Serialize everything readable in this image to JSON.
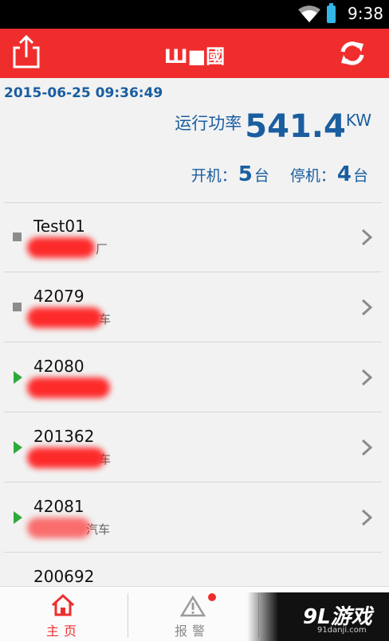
{
  "status_bar": {
    "time": "9:38"
  },
  "header": {
    "title": "Ш■國",
    "share_icon": "share-upload-icon",
    "refresh_icon": "refresh-icon",
    "accent_color": "#f02d2d"
  },
  "summary": {
    "datetime": "2015-06-25 09:36:49",
    "power_label": "运行功率",
    "power_value": "541.4",
    "power_unit": "KW",
    "running_label": "开机：",
    "running_count": "5",
    "running_unit": "台",
    "stopped_label": "停机：",
    "stopped_count": "4",
    "stopped_unit": "台",
    "text_color": "#1a5ea0"
  },
  "devices": [
    {
      "name": "Test01",
      "desc": "厂",
      "status": "stopped"
    },
    {
      "name": "42079",
      "desc": "车",
      "status": "stopped"
    },
    {
      "name": "42080",
      "desc": "",
      "status": "running"
    },
    {
      "name": "201362",
      "desc": "车",
      "status": "running"
    },
    {
      "name": "42081",
      "desc": "汽车",
      "status": "running"
    },
    {
      "name": "200692",
      "desc": "",
      "status": "unknown"
    }
  ],
  "tabs": [
    {
      "label": "主页",
      "icon": "home-icon",
      "active": true
    },
    {
      "label": "报警",
      "icon": "alert-triangle-icon",
      "active": false,
      "badge": true
    }
  ],
  "watermark": {
    "main": "9L游戏",
    "sub": "91danji.com"
  }
}
